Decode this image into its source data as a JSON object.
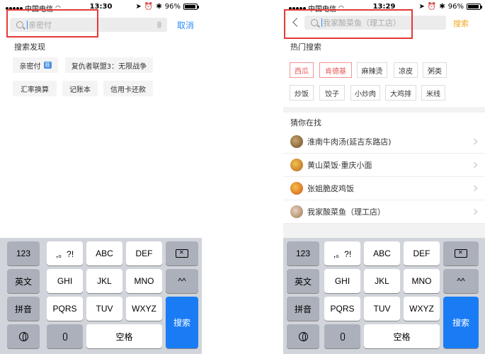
{
  "left": {
    "status": {
      "carrier": "中国电信",
      "time": "13:30",
      "battery": "96%",
      "battery_level": 0.96
    },
    "search": {
      "placeholder": "亲密付",
      "cancel_label": "取消"
    },
    "discover": {
      "title": "搜索发现",
      "tags": [
        "亲密付",
        "复仇者联盟3：无限战争",
        "汇率换算",
        "记账本",
        "信用卡还款"
      ],
      "badge": "荐"
    },
    "accent_color": "#2f8cff"
  },
  "right": {
    "status": {
      "carrier": "中国电信",
      "time": "13:29",
      "battery": "96%",
      "battery_level": 0.96
    },
    "search": {
      "placeholder": "我家酸菜鱼（理工店）",
      "button_label": "搜索"
    },
    "hot": {
      "title": "热门搜索",
      "tags": [
        "西瓜",
        "肯德基",
        "麻辣烫",
        "凉皮",
        "粥类",
        "炒饭",
        "饺子",
        "小炒肉",
        "大鸡排",
        "米线"
      ],
      "highlighted": [
        "西瓜",
        "肯德基"
      ]
    },
    "guess": {
      "title": "猜你在找",
      "items": [
        "淮南牛肉汤(延吉东路店)",
        "黄山菜饭·重庆小面",
        "张姐脆皮鸡饭",
        "我家酸菜鱼（理工店）"
      ]
    },
    "accent_color": "#f5a623"
  },
  "keyboard": {
    "row1": [
      ",。?!",
      "ABC",
      "DEF"
    ],
    "row2": [
      "GHI",
      "JKL",
      "MNO"
    ],
    "row3": [
      "PQRS",
      "TUV",
      "WXYZ"
    ],
    "num_key": "123",
    "en_key": "英文",
    "pinyin_key": "拼音",
    "face_key": "^^",
    "space_key": "空格",
    "search_key": "搜索",
    "icons": [
      "delete-icon",
      "globe-icon",
      "microphone-icon"
    ]
  },
  "highlight_color": "#e53935"
}
